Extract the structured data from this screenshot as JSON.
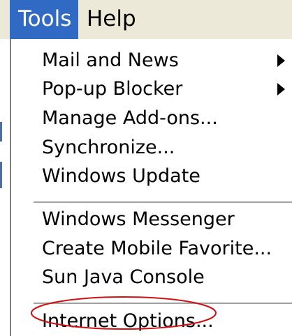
{
  "menubar": {
    "tools_label": "Tools",
    "help_label": "Help"
  },
  "menu": {
    "group1": [
      {
        "label": "Mail and News",
        "submenu": true
      },
      {
        "label": "Pop-up Blocker",
        "submenu": true
      },
      {
        "label": "Manage Add-ons...",
        "submenu": false
      },
      {
        "label": "Synchronize...",
        "submenu": false
      },
      {
        "label": "Windows Update",
        "submenu": false
      }
    ],
    "group2": [
      {
        "label": "Windows Messenger"
      },
      {
        "label": "Create Mobile Favorite..."
      },
      {
        "label": "Sun Java Console"
      }
    ],
    "group3": [
      {
        "label": "Internet Options...",
        "circled": true
      }
    ]
  },
  "colors": {
    "menu_highlight": "#316ac5",
    "annotation_circle": "#d01010",
    "menubar_bg": "#ece9d8",
    "separator": "#a0a0a0"
  },
  "icons": {
    "submenu": "triangle-right-icon"
  }
}
